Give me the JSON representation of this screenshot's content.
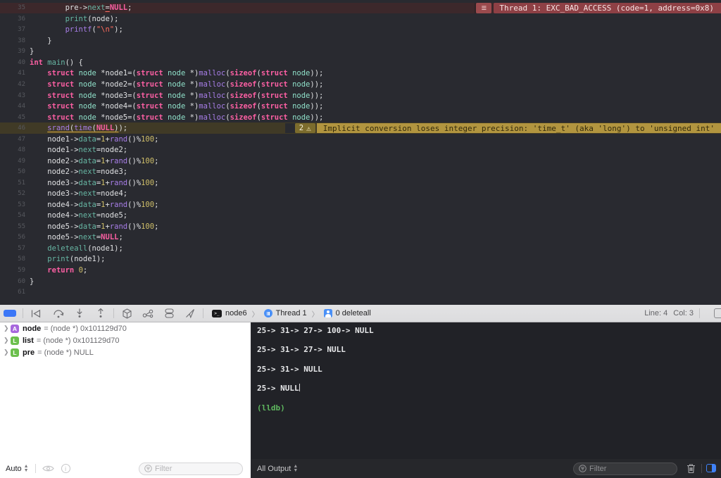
{
  "editor": {
    "error_banner": {
      "icon": "hamburger-icon",
      "text": "Thread 1: EXC_BAD_ACCESS (code=1, address=0x8)"
    },
    "warning_banner": {
      "count": "2",
      "icon": "warning-triangle-icon",
      "text": "Implicit conversion loses integer precision: 'time_t' (aka 'long') to 'unsigned int'"
    },
    "lines": [
      {
        "n": 35,
        "hl": "error",
        "tokens": [
          [
            "        pre->",
            "p"
          ],
          [
            "next",
            "m"
          ],
          [
            "=",
            "p ur"
          ],
          [
            "NULL",
            "k"
          ],
          [
            ";",
            "p"
          ]
        ]
      },
      {
        "n": 36,
        "tokens": [
          [
            "        ",
            "p"
          ],
          [
            "print",
            "m"
          ],
          [
            "(node);",
            "p"
          ]
        ]
      },
      {
        "n": 37,
        "tokens": [
          [
            "        ",
            "p"
          ],
          [
            "printf",
            "f"
          ],
          [
            "(",
            "p"
          ],
          [
            "\"\\n\"",
            "s"
          ],
          [
            ");",
            "p"
          ]
        ]
      },
      {
        "n": 38,
        "tokens": [
          [
            "    }",
            "p"
          ]
        ]
      },
      {
        "n": 39,
        "tokens": [
          [
            "}",
            "p"
          ]
        ]
      },
      {
        "n": 40,
        "tokens": [
          [
            "int",
            "k"
          ],
          [
            " ",
            "p"
          ],
          [
            "main",
            "m"
          ],
          [
            "() {",
            "p"
          ]
        ]
      },
      {
        "n": 41,
        "tokens": [
          [
            "    ",
            "p"
          ],
          [
            "struct",
            "k"
          ],
          [
            " ",
            "p"
          ],
          [
            "node",
            "t"
          ],
          [
            " *node1=(",
            "p"
          ],
          [
            "struct",
            "k"
          ],
          [
            " ",
            "p"
          ],
          [
            "node",
            "t"
          ],
          [
            " *)",
            "p"
          ],
          [
            "malloc",
            "f"
          ],
          [
            "(",
            "p"
          ],
          [
            "sizeof",
            "k"
          ],
          [
            "(",
            "p"
          ],
          [
            "struct",
            "k"
          ],
          [
            " ",
            "p"
          ],
          [
            "node",
            "t"
          ],
          [
            "));",
            "p"
          ]
        ]
      },
      {
        "n": 42,
        "tokens": [
          [
            "    ",
            "p"
          ],
          [
            "struct",
            "k"
          ],
          [
            " ",
            "p"
          ],
          [
            "node",
            "t"
          ],
          [
            " *node2=(",
            "p"
          ],
          [
            "struct",
            "k"
          ],
          [
            " ",
            "p"
          ],
          [
            "node",
            "t"
          ],
          [
            " *)",
            "p"
          ],
          [
            "malloc",
            "f"
          ],
          [
            "(",
            "p"
          ],
          [
            "sizeof",
            "k"
          ],
          [
            "(",
            "p"
          ],
          [
            "struct",
            "k"
          ],
          [
            " ",
            "p"
          ],
          [
            "node",
            "t"
          ],
          [
            "));",
            "p"
          ]
        ]
      },
      {
        "n": 43,
        "tokens": [
          [
            "    ",
            "p"
          ],
          [
            "struct",
            "k"
          ],
          [
            " ",
            "p"
          ],
          [
            "node",
            "t"
          ],
          [
            " *node3=(",
            "p"
          ],
          [
            "struct",
            "k"
          ],
          [
            " ",
            "p"
          ],
          [
            "node",
            "t"
          ],
          [
            " *)",
            "p"
          ],
          [
            "malloc",
            "f"
          ],
          [
            "(",
            "p"
          ],
          [
            "sizeof",
            "k"
          ],
          [
            "(",
            "p"
          ],
          [
            "struct",
            "k"
          ],
          [
            " ",
            "p"
          ],
          [
            "node",
            "t"
          ],
          [
            "));",
            "p"
          ]
        ]
      },
      {
        "n": 44,
        "tokens": [
          [
            "    ",
            "p"
          ],
          [
            "struct",
            "k"
          ],
          [
            " ",
            "p"
          ],
          [
            "node",
            "t"
          ],
          [
            " *node4=(",
            "p"
          ],
          [
            "struct",
            "k"
          ],
          [
            " ",
            "p"
          ],
          [
            "node",
            "t"
          ],
          [
            " *)",
            "p"
          ],
          [
            "malloc",
            "f"
          ],
          [
            "(",
            "p"
          ],
          [
            "sizeof",
            "k"
          ],
          [
            "(",
            "p"
          ],
          [
            "struct",
            "k"
          ],
          [
            " ",
            "p"
          ],
          [
            "node",
            "t"
          ],
          [
            "));",
            "p"
          ]
        ]
      },
      {
        "n": 45,
        "tokens": [
          [
            "    ",
            "p"
          ],
          [
            "struct",
            "k"
          ],
          [
            " ",
            "p"
          ],
          [
            "node",
            "t"
          ],
          [
            " *node5=(",
            "p"
          ],
          [
            "struct",
            "k"
          ],
          [
            " ",
            "p"
          ],
          [
            "node",
            "t"
          ],
          [
            " *)",
            "p"
          ],
          [
            "malloc",
            "f"
          ],
          [
            "(",
            "p"
          ],
          [
            "sizeof",
            "k"
          ],
          [
            "(",
            "p"
          ],
          [
            "struct",
            "k"
          ],
          [
            " ",
            "p"
          ],
          [
            "node",
            "t"
          ],
          [
            "));",
            "p"
          ]
        ]
      },
      {
        "n": 46,
        "hl": "warning",
        "tokens": [
          [
            "    ",
            "p"
          ],
          [
            "srand",
            "f uy"
          ],
          [
            "(",
            "p uy"
          ],
          [
            "time",
            "f uy"
          ],
          [
            "(",
            "p uy"
          ],
          [
            "NULL",
            "k uy"
          ],
          [
            ")",
            "p uy"
          ],
          [
            ");",
            "p"
          ]
        ]
      },
      {
        "n": 47,
        "tokens": [
          [
            "    node1->",
            "p"
          ],
          [
            "data",
            "m"
          ],
          [
            "=",
            "p"
          ],
          [
            "1",
            "n"
          ],
          [
            "+",
            "p"
          ],
          [
            "rand",
            "f"
          ],
          [
            "()%",
            "p"
          ],
          [
            "100",
            "n"
          ],
          [
            ";",
            "p"
          ]
        ]
      },
      {
        "n": 48,
        "tokens": [
          [
            "    node1->",
            "p"
          ],
          [
            "next",
            "m"
          ],
          [
            "=node2;",
            "p"
          ]
        ]
      },
      {
        "n": 49,
        "tokens": [
          [
            "    node2->",
            "p"
          ],
          [
            "data",
            "m"
          ],
          [
            "=",
            "p"
          ],
          [
            "1",
            "n"
          ],
          [
            "+",
            "p"
          ],
          [
            "rand",
            "f"
          ],
          [
            "()%",
            "p"
          ],
          [
            "100",
            "n"
          ],
          [
            ";",
            "p"
          ]
        ]
      },
      {
        "n": 50,
        "tokens": [
          [
            "    node2->",
            "p"
          ],
          [
            "next",
            "m"
          ],
          [
            "=node3;",
            "p"
          ]
        ]
      },
      {
        "n": 51,
        "tokens": [
          [
            "    node3->",
            "p"
          ],
          [
            "data",
            "m"
          ],
          [
            "=",
            "p"
          ],
          [
            "1",
            "n"
          ],
          [
            "+",
            "p"
          ],
          [
            "rand",
            "f"
          ],
          [
            "()%",
            "p"
          ],
          [
            "100",
            "n"
          ],
          [
            ";",
            "p"
          ]
        ]
      },
      {
        "n": 52,
        "tokens": [
          [
            "    node3->",
            "p"
          ],
          [
            "next",
            "m"
          ],
          [
            "=node4;",
            "p"
          ]
        ]
      },
      {
        "n": 53,
        "tokens": [
          [
            "    node4->",
            "p"
          ],
          [
            "data",
            "m"
          ],
          [
            "=",
            "p"
          ],
          [
            "1",
            "n"
          ],
          [
            "+",
            "p"
          ],
          [
            "rand",
            "f"
          ],
          [
            "()%",
            "p"
          ],
          [
            "100",
            "n"
          ],
          [
            ";",
            "p"
          ]
        ]
      },
      {
        "n": 54,
        "tokens": [
          [
            "    node4->",
            "p"
          ],
          [
            "next",
            "m"
          ],
          [
            "=node5;",
            "p"
          ]
        ]
      },
      {
        "n": 55,
        "tokens": [
          [
            "    node5->",
            "p"
          ],
          [
            "data",
            "m"
          ],
          [
            "=",
            "p"
          ],
          [
            "1",
            "n"
          ],
          [
            "+",
            "p"
          ],
          [
            "rand",
            "f"
          ],
          [
            "()%",
            "p"
          ],
          [
            "100",
            "n"
          ],
          [
            ";",
            "p"
          ]
        ]
      },
      {
        "n": 56,
        "tokens": [
          [
            "    node5->",
            "p"
          ],
          [
            "next",
            "m"
          ],
          [
            "=",
            "p"
          ],
          [
            "NULL",
            "k"
          ],
          [
            ";",
            "p"
          ]
        ]
      },
      {
        "n": 57,
        "tokens": [
          [
            "    ",
            "p"
          ],
          [
            "deleteall",
            "m"
          ],
          [
            "(node1);",
            "p"
          ]
        ]
      },
      {
        "n": 58,
        "tokens": [
          [
            "    ",
            "p"
          ],
          [
            "print",
            "m"
          ],
          [
            "(node1);",
            "p"
          ]
        ]
      },
      {
        "n": 59,
        "tokens": [
          [
            "    ",
            "p"
          ],
          [
            "return",
            "k"
          ],
          [
            " ",
            "p"
          ],
          [
            "0",
            "n"
          ],
          [
            ";",
            "p"
          ]
        ]
      },
      {
        "n": 60,
        "tokens": [
          [
            "}",
            "p"
          ]
        ]
      },
      {
        "n": 61,
        "tokens": []
      }
    ]
  },
  "debug_toolbar": {
    "icons": [
      "breakpoints-toggle",
      "continue-execution",
      "step-over",
      "step-into",
      "step-out",
      "debug-view-hierarchy",
      "memory-graph",
      "environment-overrides",
      "simulate-location"
    ],
    "breadcrumb": {
      "target": "node6",
      "thread": "Thread 1",
      "frame": "0 deleteall"
    },
    "line_label": "Line: 4",
    "col_label": "Col: 3"
  },
  "variables": {
    "rows": [
      {
        "badge": "A",
        "badge_color": "#a767dd",
        "name": "node",
        "value": "= (node *) 0x101129d70"
      },
      {
        "badge": "L",
        "badge_color": "#6cbf4d",
        "name": "list",
        "value": "= (node *) 0x101129d70"
      },
      {
        "badge": "L",
        "badge_color": "#6cbf4d",
        "name": "pre",
        "value": "= (node *) NULL"
      }
    ],
    "bar": {
      "scope_label": "Auto",
      "filter_placeholder": "Filter"
    }
  },
  "console": {
    "lines": [
      {
        "text": "25-> 31-> 27-> 100-> NULL",
        "cls": "out"
      },
      {
        "text": "",
        "cls": "out"
      },
      {
        "text": "25-> 31-> 27-> NULL",
        "cls": "out"
      },
      {
        "text": "",
        "cls": "out"
      },
      {
        "text": "25-> 31-> NULL",
        "cls": "out"
      },
      {
        "text": "",
        "cls": "out"
      },
      {
        "text": "25-> NULL",
        "cls": "out",
        "cursor": true
      },
      {
        "text": "",
        "cls": "out"
      },
      {
        "text": "(lldb)",
        "cls": "lldb"
      }
    ],
    "bar": {
      "output_label": "All Output",
      "filter_placeholder": "Filter"
    }
  },
  "icons_legend": {
    "hamburger-icon": "≡",
    "warning-triangle-icon": "⚠",
    "chevron-separator-icon": "〉",
    "terminal-target-icon": ">_",
    "thread-pause-icon": "pause-circle",
    "stack-frame-person-icon": "person",
    "eye-icon": "quicklook-eye",
    "info-icon": "ⓘ",
    "filter-icon": "circled-filter-lines",
    "trash-icon": "wastebasket",
    "console-toggle-icon": "pane-right-filled"
  }
}
